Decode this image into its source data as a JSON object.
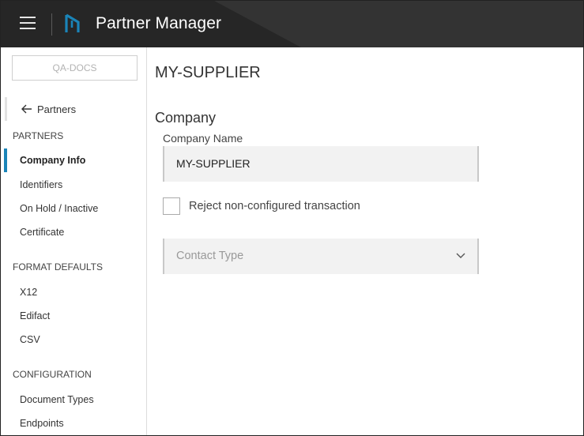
{
  "header": {
    "menu_icon": "hamburger-menu-icon",
    "logo_icon": "partner-manager-logo-icon",
    "app_title": "Partner Manager",
    "colors": {
      "background": "#262626",
      "accent": "#1a84b8"
    }
  },
  "sidebar": {
    "org_selector": "QA-DOCS",
    "back_link": {
      "icon": "arrow-left-icon",
      "label": "Partners"
    },
    "sections": [
      {
        "label": "PARTNERS",
        "items": [
          {
            "label": "Company Info",
            "active": true
          },
          {
            "label": "Identifiers"
          },
          {
            "label": "On Hold / Inactive"
          },
          {
            "label": "Certificate"
          }
        ]
      },
      {
        "label": "FORMAT DEFAULTS",
        "items": [
          {
            "label": "X12"
          },
          {
            "label": "Edifact"
          },
          {
            "label": "CSV"
          }
        ]
      },
      {
        "label": "CONFIGURATION",
        "items": [
          {
            "label": "Document Types"
          },
          {
            "label": "Endpoints"
          }
        ]
      }
    ]
  },
  "main": {
    "page_title": "MY-SUPPLIER",
    "section_title": "Company",
    "company_name": {
      "label": "Company Name",
      "value": "MY-SUPPLIER"
    },
    "reject_checkbox": {
      "label": "Reject non-configured transaction",
      "checked": false
    },
    "contact_type": {
      "placeholder": "Contact Type",
      "icon": "chevron-down-icon"
    }
  }
}
